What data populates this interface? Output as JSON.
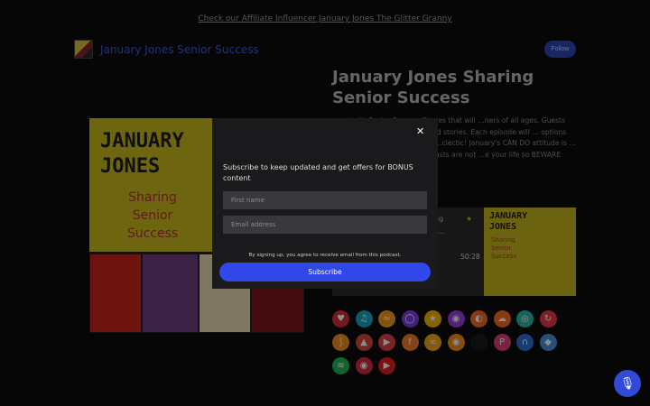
{
  "banner": {
    "link_text": "Check our Affiliate Influencer January Jones The Glitter Granny"
  },
  "header": {
    "show_title": "January Jones Senior Success",
    "follow_label": "Follow"
  },
  "episode": {
    "title": "January Jones Sharing Senior Success",
    "description": "…ast with Senior Success Stories that will …ners of all ages. Guests will share the …ir own lives and stories. Each episode will … options that will make their own lives …clectic! January's CAN DO attitude is …elling. Disclaimer: These podcasts are not …e your life so BEWARE before you listen."
  },
  "cover": {
    "line1": "JANUARY",
    "line2": "JONES",
    "subtitle": "Sharing Senior Success"
  },
  "player": {
    "episode_fragment": "…ng\nwit…",
    "time": "50:28",
    "thumb_title": "JANUARY\nJONES",
    "thumb_subtitle": "Sharing\nSenior\nSuccess"
  },
  "platform_icons": [
    {
      "name": "iheart-icon",
      "color": "#d22d3b",
      "glyph": "♥"
    },
    {
      "name": "amazon-music-icon",
      "color": "#1aa4c0",
      "glyph": "♫"
    },
    {
      "name": "audible-icon",
      "color": "#f39a1e",
      "glyph": "≈"
    },
    {
      "name": "castbox-icon",
      "color": "#7b3fe4",
      "glyph": "◯"
    },
    {
      "name": "stitcher-icon",
      "color": "#f4b400",
      "glyph": "★"
    },
    {
      "name": "apple-podcasts-icon",
      "color": "#9a3ee0",
      "glyph": "◉"
    },
    {
      "name": "pocketcasts-icon",
      "color": "#f06a22",
      "glyph": "◐"
    },
    {
      "name": "soundcloud-icon",
      "color": "#f16b22",
      "glyph": "☁"
    },
    {
      "name": "podchaser-icon",
      "color": "#29b6a8",
      "glyph": "◎"
    },
    {
      "name": "podbean-icon",
      "color": "#e63a4a",
      "glyph": "↻"
    },
    {
      "name": "rss-icon",
      "color": "#f28c1c",
      "glyph": "⟆"
    },
    {
      "name": "deezer-icon",
      "color": "#d6443c",
      "glyph": "▲"
    },
    {
      "name": "castro-icon",
      "color": "#e0414a",
      "glyph": "▶"
    },
    {
      "name": "podfriend-icon",
      "color": "#f07c28",
      "glyph": "f"
    },
    {
      "name": "podcast-addict-icon",
      "color": "#f0a51c",
      "glyph": "∞"
    },
    {
      "name": "player-fm-icon",
      "color": "#f08a1a",
      "glyph": "◉"
    },
    {
      "name": "blank-icon",
      "color": "#1a1a1a",
      "glyph": ""
    },
    {
      "name": "podcast-republic-icon",
      "color": "#e0407a",
      "glyph": "P"
    },
    {
      "name": "headphones-icon",
      "color": "#2a6fd0",
      "glyph": "∩"
    },
    {
      "name": "google-podcasts-icon",
      "color": "#4a90d9",
      "glyph": "◆"
    },
    {
      "name": "spotify-icon",
      "color": "#1db954",
      "glyph": "≋"
    },
    {
      "name": "radio-public-icon",
      "color": "#d22d3b",
      "glyph": "◉"
    },
    {
      "name": "youtube-icon",
      "color": "#e02020",
      "glyph": "▶"
    }
  ],
  "modal": {
    "message": "Subscribe to keep updated and get offers for BONUS content",
    "first_name_placeholder": "First name",
    "email_placeholder": "Email address",
    "terms": "By signing up, you agree to receive email from this podcast.",
    "subscribe_label": "Subscribe"
  }
}
